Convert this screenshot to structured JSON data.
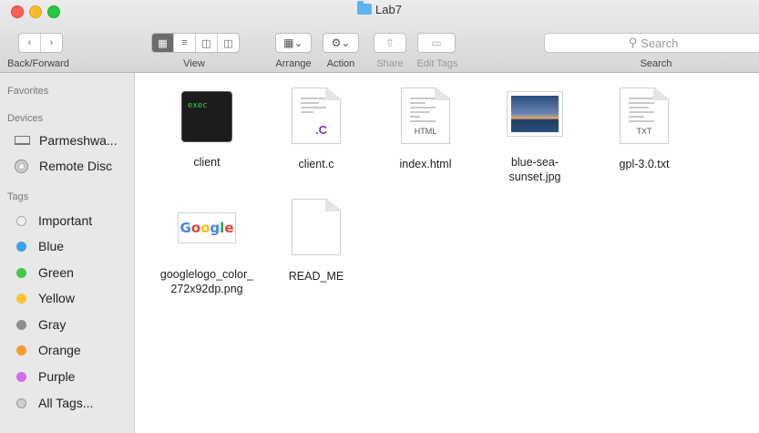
{
  "window": {
    "title": "Lab7"
  },
  "toolbar": {
    "back_forward_label": "Back/Forward",
    "view_label": "View",
    "arrange_label": "Arrange",
    "action_label": "Action",
    "share_label": "Share",
    "edit_tags_label": "Edit Tags",
    "search_label": "Search",
    "search_placeholder": "Search"
  },
  "sidebar": {
    "favorites_header": "Favorites",
    "devices_header": "Devices",
    "devices": [
      {
        "label": "Parmeshwa..."
      },
      {
        "label": "Remote Disc"
      }
    ],
    "tags_header": "Tags",
    "tags": [
      {
        "label": "Important",
        "color": "#e0e0e0"
      },
      {
        "label": "Blue",
        "color": "#3aa0f2"
      },
      {
        "label": "Green",
        "color": "#46c74a"
      },
      {
        "label": "Yellow",
        "color": "#fdc42e"
      },
      {
        "label": "Gray",
        "color": "#8e8e8e"
      },
      {
        "label": "Orange",
        "color": "#fd9a2d"
      },
      {
        "label": "Purple",
        "color": "#cf6ee8"
      },
      {
        "label": "All Tags...",
        "color": "#cfcfcf"
      }
    ]
  },
  "files": [
    {
      "name": "client",
      "icon": "terminal-exec-icon",
      "icon_text": "exec"
    },
    {
      "name": "client.c",
      "icon": "c-source-icon",
      "icon_text": ".C"
    },
    {
      "name": "index.html",
      "icon": "html-document-icon",
      "icon_text": "HTML"
    },
    {
      "name": "blue-sea-",
      "name_line2": "sunset.jpg",
      "icon": "image-thumbnail-icon"
    },
    {
      "name": "gpl-3.0.txt",
      "icon": "text-document-icon",
      "icon_text": "TXT"
    },
    {
      "name": "googlelogo_color_",
      "name_line2": "272x92dp.png",
      "icon": "google-logo-icon"
    },
    {
      "name": "READ_ME",
      "icon": "blank-document-icon"
    }
  ]
}
